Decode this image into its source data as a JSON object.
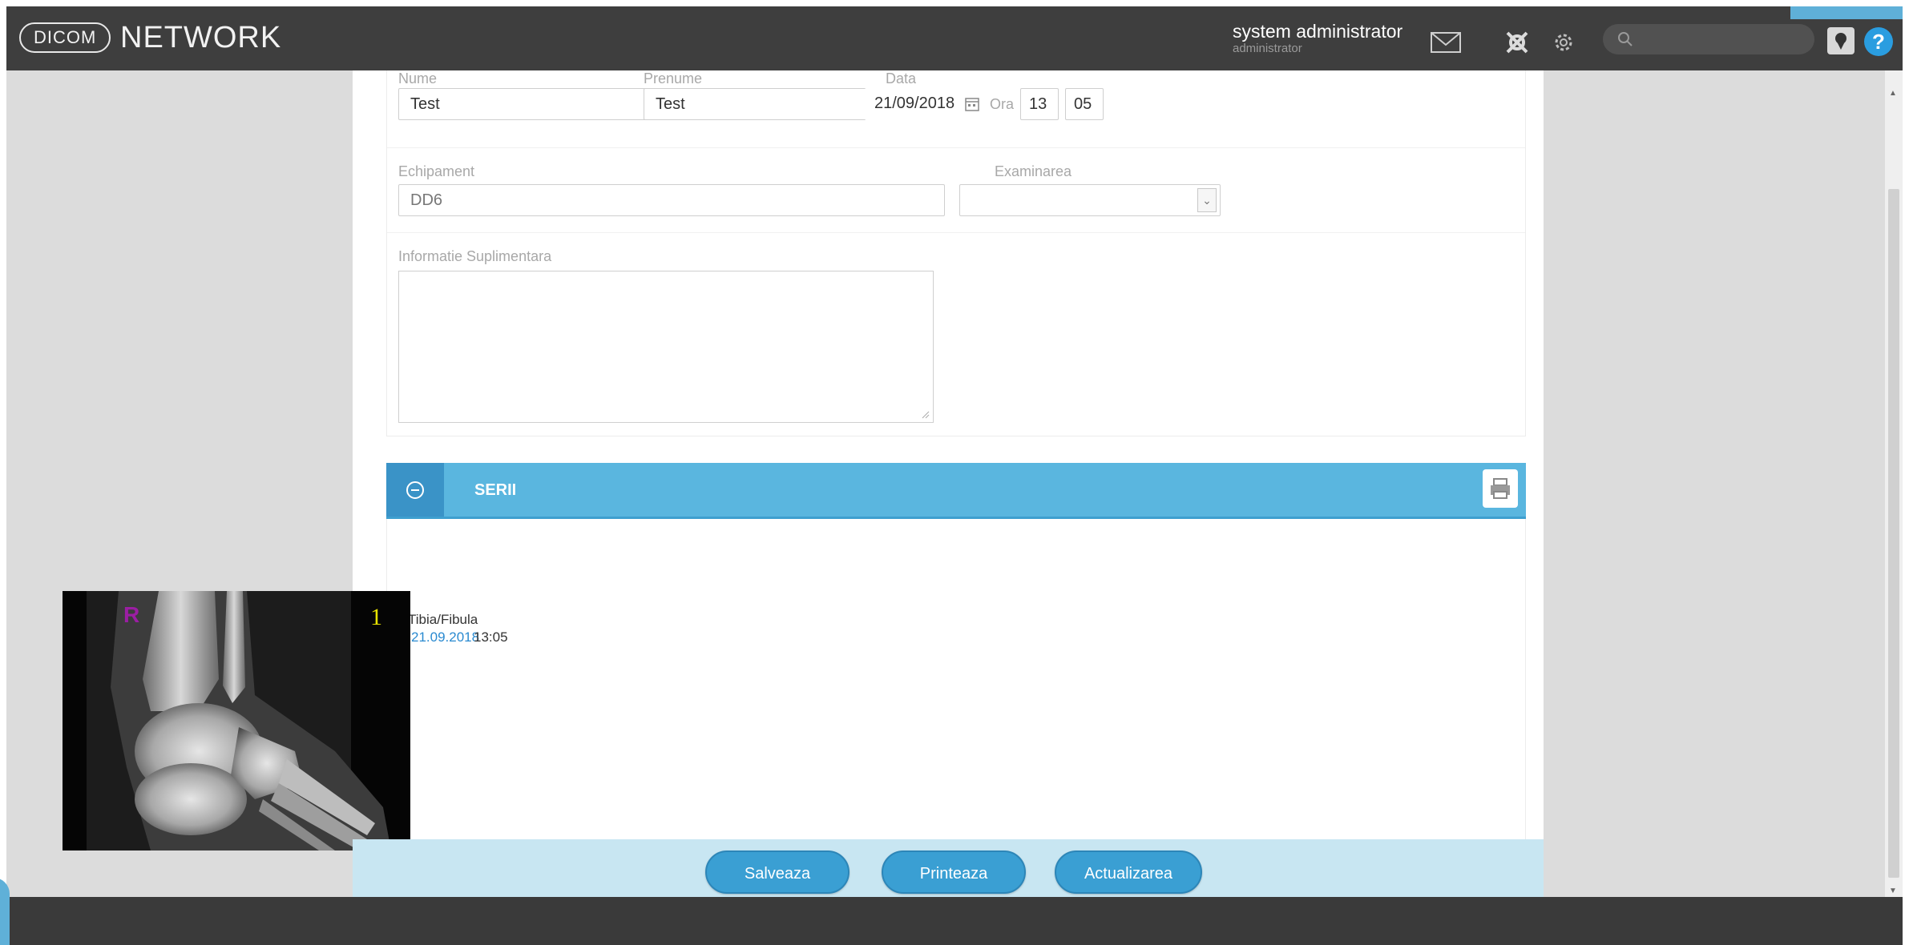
{
  "header": {
    "logo_badge": "DICOM",
    "logo_text": "NETWORK",
    "user_name": "system administrator",
    "user_role": "administrator",
    "search_placeholder": ""
  },
  "form": {
    "nume": {
      "label": "Nume",
      "value": "Test"
    },
    "prenume": {
      "label": "Prenume",
      "value": "Test"
    },
    "data": {
      "label": "Data",
      "value": "21/09/2018"
    },
    "ora": {
      "label": "Ora",
      "hour": "13",
      "minute": "05"
    },
    "echipament": {
      "label": "Echipament",
      "value": "DD6"
    },
    "examinarea": {
      "label": "Examinarea",
      "value": ""
    },
    "informatie": {
      "label": "Informatie Suplimentara",
      "value": ""
    }
  },
  "series": {
    "title": "SERII",
    "items": [
      {
        "name": "Tibia/Fibula",
        "date": "21.09.2018",
        "time": "13:05",
        "marker_left": "R",
        "marker_right": "1"
      }
    ]
  },
  "actions": {
    "save": "Salveaza",
    "print": "Printeaza",
    "update": "Actualizarea"
  },
  "colors": {
    "topbar": "#3e3e3e",
    "accent": "#5ab6df",
    "button": "#3a9fd3",
    "link": "#2a8ad0"
  },
  "icons": [
    "envelope-icon",
    "tools-icon",
    "gear-icon",
    "search-icon",
    "pin-icon",
    "help-icon",
    "calendar-icon",
    "collapse-icon",
    "print-icon"
  ]
}
